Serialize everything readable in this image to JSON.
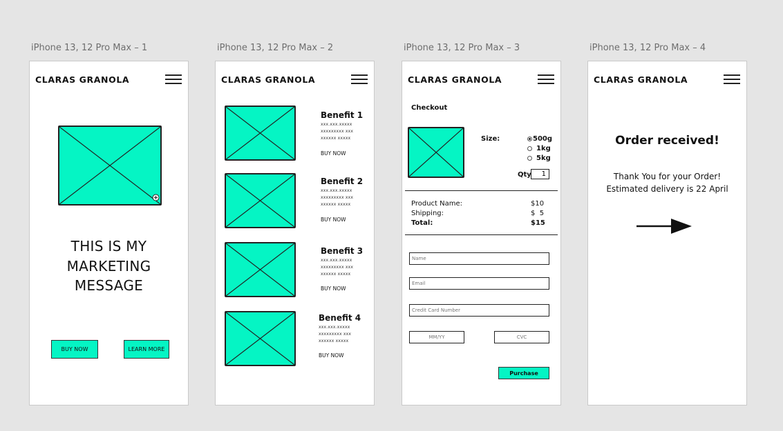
{
  "artboards": [
    {
      "label": "iPhone 13, 12 Pro Max – 1"
    },
    {
      "label": "iPhone 13, 12 Pro Max – 2"
    },
    {
      "label": "iPhone 13, 12 Pro Max – 3"
    },
    {
      "label": "iPhone 13, 12 Pro Max – 4"
    }
  ],
  "brand": "CLARAS GRANOLA",
  "home": {
    "message_lines": [
      "THIS IS MY",
      "MARKETING",
      "MESSAGE"
    ],
    "buy_now": "BUY NOW",
    "learn_more": "LEARN MORE"
  },
  "benefits": {
    "items": [
      {
        "title": "Benefit 1",
        "lines": [
          "xxx.xxx.xxxxx",
          "xxxxxxxxx xxx",
          "xxxxxx xxxxx"
        ],
        "buy": "BUY NOW"
      },
      {
        "title": "Benefit 2",
        "lines": [
          "xxx.xxx.xxxxx",
          "xxxxxxxxx xxx",
          "xxxxxx xxxxx"
        ],
        "buy": "BUY NOW"
      },
      {
        "title": "Benefit 3",
        "lines": [
          "xxx.xxx.xxxxx",
          "xxxxxxxxx xxx",
          "xxxxxx xxxxx"
        ],
        "buy": "BUY NOW"
      },
      {
        "title": "Benefit 4",
        "lines": [
          "xxx.xxx.xxxxx",
          "xxxxxxxxx xxx",
          "xxxxxx xxxxx"
        ],
        "buy": "BUY NOW"
      }
    ]
  },
  "checkout": {
    "heading": "Checkout",
    "size_label": "Size:",
    "sizes": [
      {
        "label": "500g",
        "selected": true
      },
      {
        "label": "1kg",
        "selected": false
      },
      {
        "label": "5kg",
        "selected": false
      }
    ],
    "qty_label": "Qty",
    "qty_value": "1",
    "summary": {
      "product_label": "Product Name:",
      "product_value": "$10",
      "shipping_label": "Shipping:",
      "shipping_value": "$  5",
      "total_label": "Total:",
      "total_value": "$15"
    },
    "fields": {
      "name": "Name",
      "email": "Email",
      "card": "Credit Card Number",
      "expiry": "MM/YY",
      "cvc": "CVC"
    },
    "purchase": "Purchase"
  },
  "confirmation": {
    "title": "Order received!",
    "line1": "Thank You for your Order!",
    "line2": "Estimated delivery is 22 April"
  },
  "colors": {
    "accent": "#05f5c4",
    "background": "#e5e5e5"
  }
}
